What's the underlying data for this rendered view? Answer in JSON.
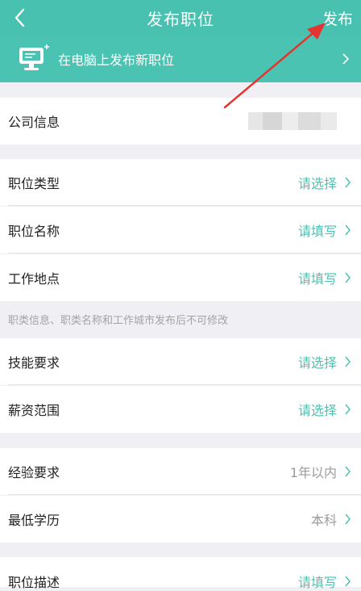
{
  "header": {
    "back_icon": "chevron-left-icon",
    "title": "发布职位",
    "publish_label": "发布"
  },
  "banner": {
    "icon": "desktop-computer-icon",
    "text": "在电脑上发布新职位"
  },
  "company": {
    "label": "公司信息"
  },
  "section1": {
    "items": [
      {
        "label": "职位类型",
        "value": "请选择"
      },
      {
        "label": "职位名称",
        "value": "请填写"
      },
      {
        "label": "工作地点",
        "value": "请填写"
      }
    ]
  },
  "note": "职类信息、职类名称和工作城市发布后不可修改",
  "section2": {
    "items": [
      {
        "label": "技能要求",
        "value": "请选择"
      },
      {
        "label": "薪资范围",
        "value": "请选择"
      }
    ]
  },
  "section3": {
    "items": [
      {
        "label": "经验要求",
        "value": "1年以内"
      },
      {
        "label": "最低学历",
        "value": "本科"
      }
    ]
  },
  "section4": {
    "items": [
      {
        "label": "职位描述",
        "value": "请填写"
      }
    ]
  },
  "colors": {
    "accent": "#48c1b0",
    "value_green": "#4bc3b2",
    "annotation_red": "#e3342f"
  }
}
